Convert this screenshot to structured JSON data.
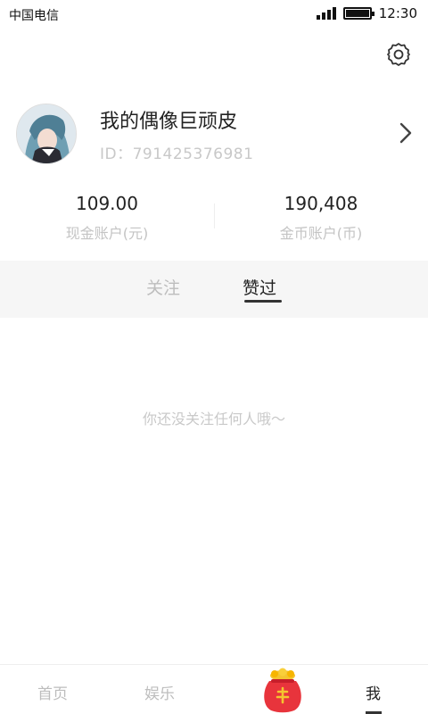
{
  "status_bar": {
    "carrier": "中国电信",
    "time": "12:30",
    "signal_bars": 4,
    "battery_level": 0.9
  },
  "header": {
    "settings_icon": "gear-icon"
  },
  "profile": {
    "nickname": "我的偶像巨顽皮",
    "id_text": "ID：791425376981",
    "avatar": "anime-avatar",
    "chevron_icon": "chevron-right-icon"
  },
  "accounts": [
    {
      "value": "109.00",
      "label": "现金账户(元)"
    },
    {
      "value": "190,408",
      "label": "金币账户(币)"
    }
  ],
  "tabs": {
    "follow": "关注",
    "liked": "赞过",
    "active": "liked"
  },
  "empty_message": "你还没关注任何人哦～",
  "bottom_nav": {
    "home": "首页",
    "fun": "娱乐",
    "bag_icon": "lucky-bag-icon",
    "me": "我",
    "active": "me"
  },
  "colors": {
    "accent_red": "#e8343c",
    "gold": "#f4c430"
  }
}
